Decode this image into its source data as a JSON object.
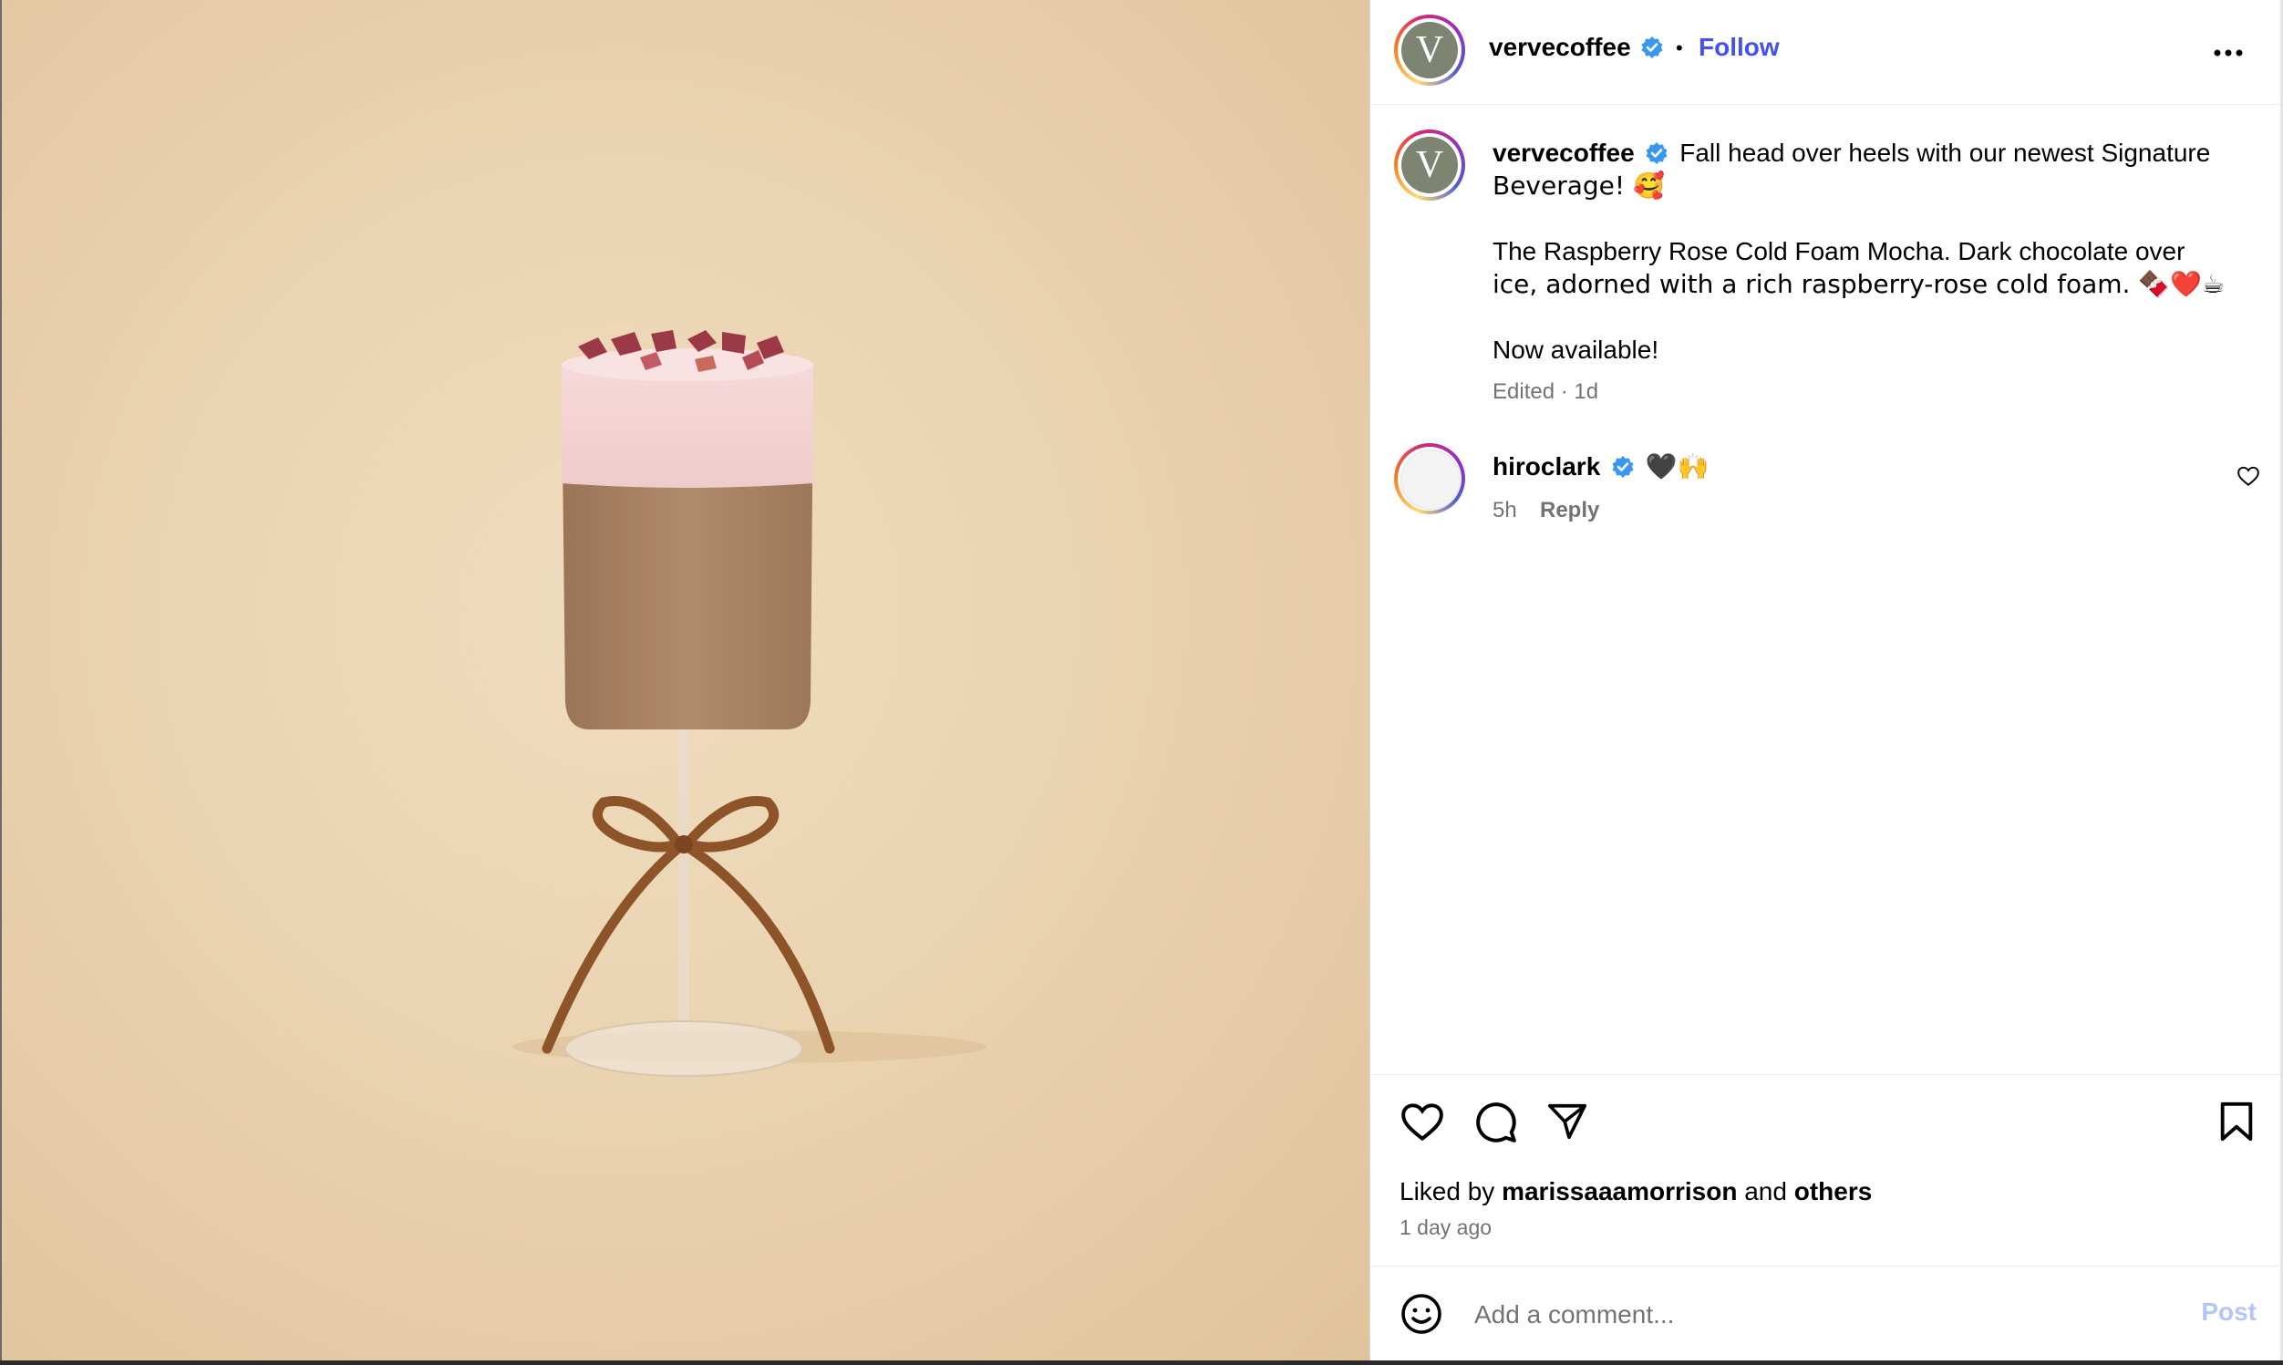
{
  "post": {
    "username": "vervecoffee",
    "avatar_letter": "V",
    "follow_label": "Follow",
    "separator": "•",
    "more_label": "•••"
  },
  "caption": {
    "username": "vervecoffee",
    "line1": "Fall head over heels with our newest Signature",
    "line2": "Beverage! 🥰",
    "line3": "The Raspberry Rose Cold Foam Mocha. Dark chocolate over",
    "line4": "ice, adorned with a rich raspberry-rose cold foam. 🍫❤️☕",
    "line5": "Now available!",
    "meta": "Edited · 1d"
  },
  "comments": [
    {
      "username": "hiroclark",
      "text": "🖤🙌",
      "time": "5h",
      "reply_label": "Reply"
    }
  ],
  "likes": {
    "prefix": "Liked by",
    "user": "marissaaamorrison",
    "middle": "and",
    "others": "others",
    "time_ago": "1 day ago"
  },
  "comment_box": {
    "placeholder": "Add a comment...",
    "post_label": "Post"
  },
  "colors": {
    "accent": "#4150f7",
    "verified": "#3897f0",
    "muted": "#737373",
    "post_disabled": "#b3c6f7",
    "avatar_bg": "#7d8471"
  },
  "icons": [
    "heart-icon",
    "comment-icon",
    "share-icon",
    "bookmark-icon",
    "emoji-icon",
    "verified-icon",
    "more-icon"
  ]
}
